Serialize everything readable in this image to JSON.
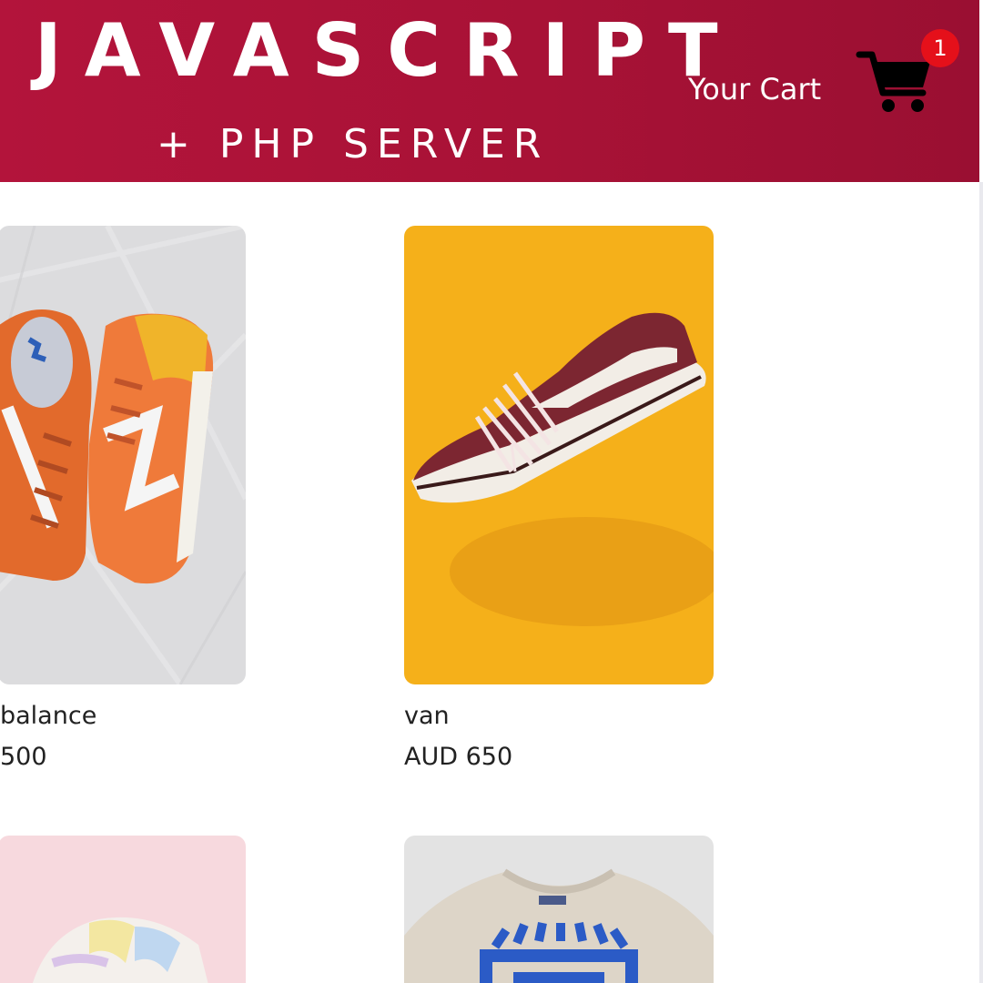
{
  "header": {
    "title": "JAVASCRIPT",
    "subtitle": "+ PHP SERVER",
    "cart_label": "Your Cart",
    "cart_count": "1",
    "colors": {
      "header_background": "#a81236",
      "badge": "#e5101a"
    }
  },
  "products": [
    {
      "name": "balance",
      "price": "500",
      "image": "orange-new-balance-sneakers-on-marble"
    },
    {
      "name": "van",
      "price": "AUD 650",
      "image": "maroon-vans-sneaker-on-yellow"
    },
    {
      "image": "pastel-sneaker-on-pink"
    },
    {
      "image": "beige-graphic-tshirt"
    }
  ],
  "icons": {
    "cart": "shopping-cart-icon"
  }
}
